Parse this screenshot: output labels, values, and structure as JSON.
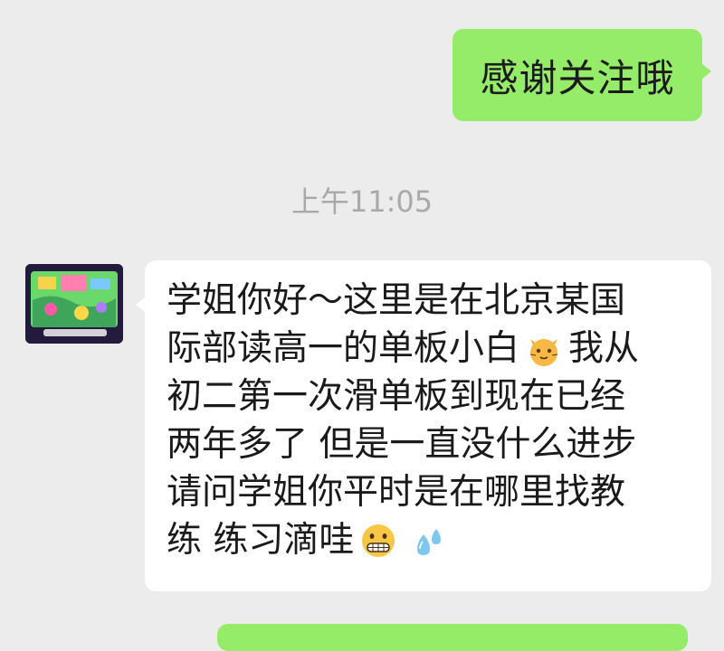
{
  "outgoing": {
    "text": "感谢关注哦"
  },
  "timestamp": "上午11:05",
  "incoming": {
    "lines": [
      {
        "a": "学姐你好～这里是在北京某国"
      },
      {
        "a": "际部读高一的单板小白",
        "emoji": "cat-face-icon",
        "b": "我从"
      },
      {
        "a": "初二第一次滑单板到现在已经"
      },
      {
        "a": "两年多了 但是一直没什么进步"
      },
      {
        "a": "请问学姐你平时是在哪里找教"
      },
      {
        "a": "练 练习滴哇"
      }
    ]
  },
  "colors": {
    "background": "#ececec",
    "outgoing_bubble": "#95ec69",
    "incoming_bubble": "#ffffff",
    "timestamp_text": "#a9a9a9"
  }
}
